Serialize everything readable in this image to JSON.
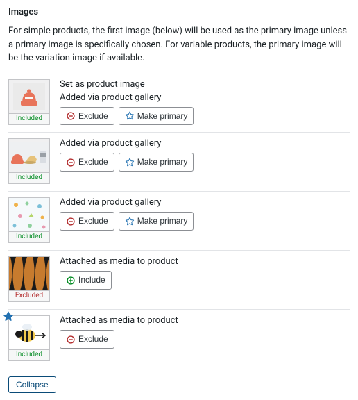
{
  "section_title": "Images",
  "help_text": "For simple products, the first image (below) will be used as the primary image unless a primary image is specifically chosen. For variable products, the primary image will be the variation image if available.",
  "status": {
    "included": "Included",
    "excluded": "Excluded"
  },
  "labels": {
    "set_as_product_image": "Set as product image",
    "added_via_gallery": "Added via product gallery",
    "attached_as_media": "Attached as media to product"
  },
  "buttons": {
    "exclude": "Exclude",
    "include": "Include",
    "make_primary": "Make primary",
    "collapse": "Collapse"
  },
  "items": [
    {
      "thumb": "beanie",
      "status": "included",
      "lines": [
        "set_as_product_image",
        "added_via_gallery"
      ],
      "actions": [
        "exclude",
        "make_primary"
      ],
      "primary_star": false
    },
    {
      "thumb": "three_products",
      "status": "included",
      "lines": [
        "added_via_gallery"
      ],
      "actions": [
        "exclude",
        "make_primary"
      ],
      "primary_star": false
    },
    {
      "thumb": "pattern",
      "status": "included",
      "lines": [
        "added_via_gallery"
      ],
      "actions": [
        "exclude",
        "make_primary"
      ],
      "primary_star": false
    },
    {
      "thumb": "tiger",
      "status": "excluded",
      "lines": [
        "attached_as_media"
      ],
      "actions": [
        "include"
      ],
      "primary_star": false
    },
    {
      "thumb": "bee",
      "status": "included",
      "lines": [
        "attached_as_media"
      ],
      "actions": [
        "exclude"
      ],
      "primary_star": true
    }
  ],
  "colors": {
    "exclude_icon": "#b32d2e",
    "include_icon": "#008a20",
    "primary_icon": "#2271b1"
  }
}
